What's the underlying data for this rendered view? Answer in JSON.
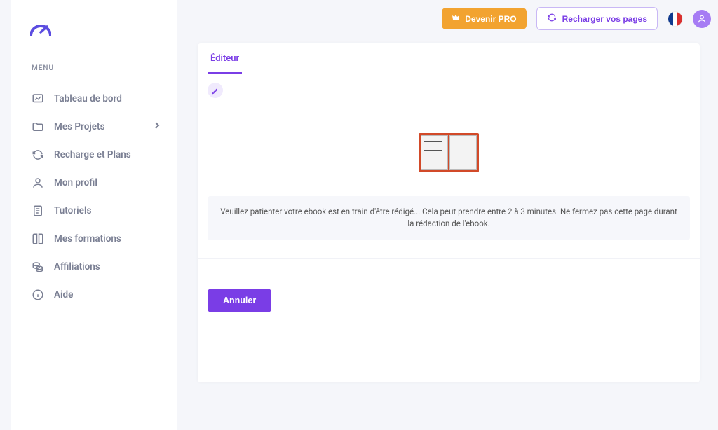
{
  "sidebar": {
    "menu_label": "MENU",
    "items": [
      {
        "label": "Tableau de bord",
        "name": "sidebar-item-dashboard"
      },
      {
        "label": "Mes Projets",
        "name": "sidebar-item-projects",
        "chevron": true
      },
      {
        "label": "Recharge et Plans",
        "name": "sidebar-item-plans"
      },
      {
        "label": "Mon profil",
        "name": "sidebar-item-profile"
      },
      {
        "label": "Tutoriels",
        "name": "sidebar-item-tutorials"
      },
      {
        "label": "Mes formations",
        "name": "sidebar-item-courses"
      },
      {
        "label": "Affiliations",
        "name": "sidebar-item-affiliations"
      },
      {
        "label": "Aide",
        "name": "sidebar-item-help"
      }
    ]
  },
  "header": {
    "pro_label": "Devenir PRO",
    "reload_label": "Recharger vos pages"
  },
  "editor": {
    "tab_label": "Éditeur",
    "status_message": "Veuillez patienter votre ebook est en train d'être rédigé... Cela peut prendre entre 2 à 3 minutes. Ne fermez pas cette page durant la rédaction de l'ebook.",
    "cancel_label": "Annuler"
  }
}
